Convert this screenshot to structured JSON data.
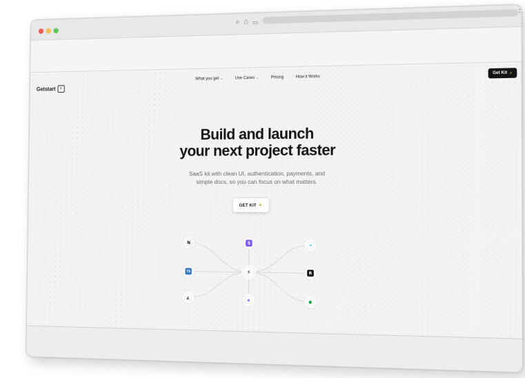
{
  "browser": {
    "window_controls": [
      "close",
      "minimize",
      "maximize"
    ],
    "icons": [
      "search-icon",
      "home-icon",
      "tab-icon",
      "more-menu-icon"
    ],
    "glyphs": {
      "search": "⌕",
      "home": "⌂",
      "tab": "▭",
      "menu": "⋮"
    }
  },
  "header": {
    "brand": "Getstart",
    "brand_icon": "⚡",
    "nav": [
      {
        "label": "What you get",
        "has_dropdown": true
      },
      {
        "label": "Use Cases",
        "has_dropdown": true
      },
      {
        "label": "Pricing",
        "has_dropdown": false
      },
      {
        "label": "How it Works",
        "has_dropdown": false
      }
    ],
    "cta": "Get Kit",
    "cta_icon": "⚡",
    "dropdown_glyph": "⌄"
  },
  "hero": {
    "title_line1": "Build and launch",
    "title_line2": "your next project faster",
    "subtitle_line1": "SaaS kit with clean UI, authentication, payments, and",
    "subtitle_line2": "simple docs, so you can focus on what matters.",
    "cta": "GET KIT",
    "cta_icon": "✦"
  },
  "integrations": {
    "center": {
      "name": "bolt-icon",
      "glyph": "⚡"
    },
    "nodes": [
      {
        "name": "nextjs-icon",
        "glyph": "N",
        "bg": "#ffffff",
        "fg": "#111111"
      },
      {
        "name": "stripe-icon",
        "glyph": "S",
        "bg": "#7a5af8",
        "fg": "#ffffff"
      },
      {
        "name": "tailwind-icon",
        "glyph": "≈",
        "bg": "#ffffff",
        "fg": "#38bdf8"
      },
      {
        "name": "typescript-icon",
        "glyph": "TS",
        "bg": "#3178c6",
        "fg": "#ffffff"
      },
      {
        "name": "resend-icon",
        "glyph": "R",
        "bg": "#111111",
        "fg": "#ffffff"
      },
      {
        "name": "prisma-icon",
        "glyph": "◭",
        "bg": "#ffffff",
        "fg": "#111111"
      },
      {
        "name": "shield-icon",
        "glyph": "◈",
        "bg": "#ffffff",
        "fg": "#6d5dfc"
      },
      {
        "name": "mongodb-icon",
        "glyph": "●",
        "bg": "#ffffff",
        "fg": "#22a052"
      }
    ]
  }
}
